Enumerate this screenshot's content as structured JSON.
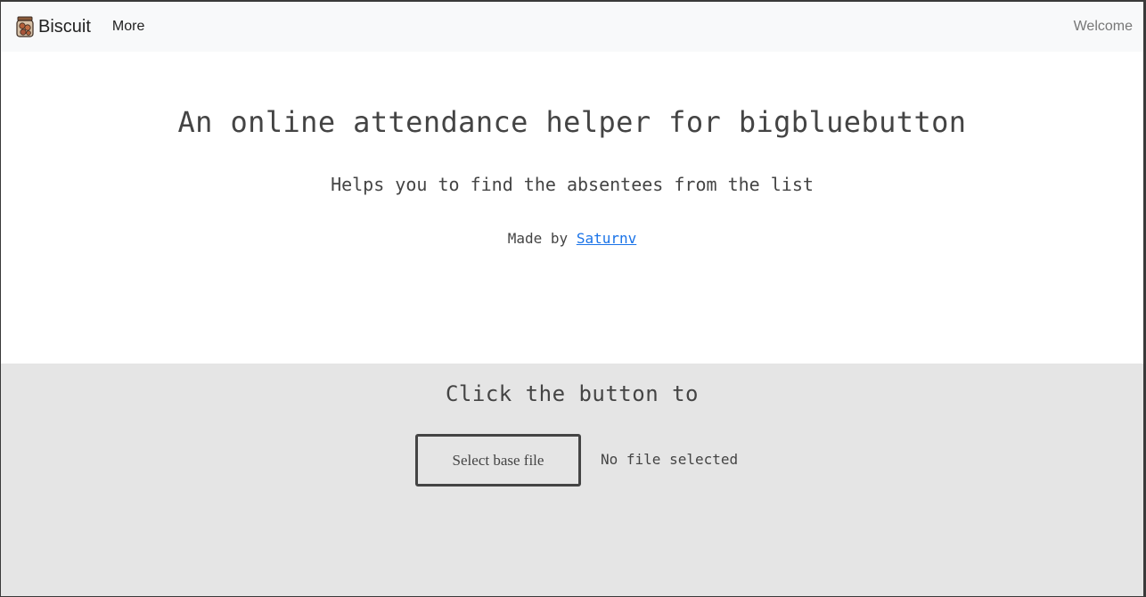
{
  "navbar": {
    "brand_label": "Biscuit",
    "brand_icon": "biscuit-jar-icon",
    "more_label": "More",
    "welcome_label": "Welcome"
  },
  "hero": {
    "title": "An online attendance helper for bigbluebutton",
    "subtitle": "Helps you to find the absentees from the list",
    "credit_prefix": "Made by",
    "credit_link": "Saturnv"
  },
  "upload": {
    "heading": "Click the button to",
    "button_label": "Select base file",
    "status": "No file selected"
  },
  "colors": {
    "navbar_bg": "#f8f9fa",
    "upload_bg": "#e5e5e5",
    "link": "#1a73e8",
    "text": "#444444"
  }
}
